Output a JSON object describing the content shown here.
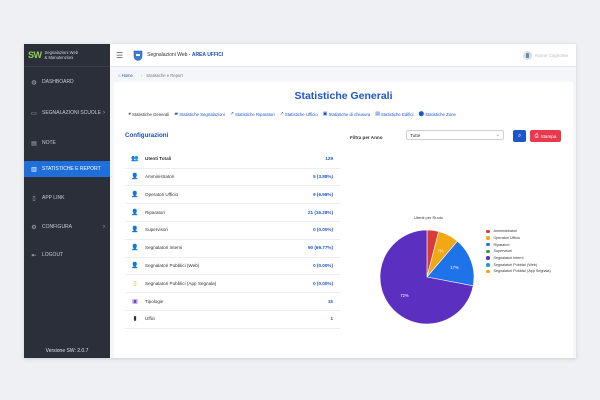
{
  "sidebar": {
    "logo": "SW",
    "brand_line1": "Segnalazioni Web",
    "brand_line2": "& Manutenzioni",
    "items": [
      {
        "label": "DASHBOARD",
        "icon": "dashboard-icon",
        "glyph": "◍",
        "chevron": ""
      },
      {
        "label": "SEGNALAZIONI SCUOLE",
        "icon": "message-icon",
        "glyph": "▭",
        "chevron": "›"
      },
      {
        "label": "NOTE",
        "icon": "notes-icon",
        "glyph": "▤",
        "chevron": ""
      },
      {
        "label": "STATISTICHE E REPORT",
        "icon": "chart-icon",
        "glyph": "▥",
        "chevron": ""
      },
      {
        "label": "APP LINK",
        "icon": "phone-icon",
        "glyph": "▯",
        "chevron": ""
      },
      {
        "label": "CONFIGURA",
        "icon": "gear-icon",
        "glyph": "⚙",
        "chevron": "›"
      },
      {
        "label": "LOGOUT",
        "icon": "logout-icon",
        "glyph": "⇤",
        "chevron": ""
      }
    ],
    "active_index": 3,
    "version": "Versione SW: 2.0.7"
  },
  "header": {
    "title_prefix": "Segnalazioni Web - ",
    "title_area": "AREA UFFICI",
    "user_name": "Nome Cognome"
  },
  "breadcrumb": {
    "home": "Home",
    "current": "Statistiche e Report"
  },
  "page_title": "Statistiche Generali",
  "tabs": [
    {
      "label": "Statistiche Generali",
      "glyph": "◕"
    },
    {
      "label": "Statistiche Segnalazioni",
      "glyph": "▰"
    },
    {
      "label": "Statistiche Riparatori",
      "glyph": "↗"
    },
    {
      "label": "Statistiche Ufficio",
      "glyph": "↗"
    },
    {
      "label": "Statistiche di chiusura",
      "glyph": "▣"
    },
    {
      "label": "Statistiche Edifici",
      "glyph": "▤"
    },
    {
      "label": "Statistiche Zone",
      "glyph": "⬤"
    }
  ],
  "config_title": "Configurazioni",
  "stats": [
    {
      "label": "Utenti Totali",
      "value": "129",
      "bold": true,
      "glyph": "👥",
      "color": "#1e56c8"
    },
    {
      "label": "Amministratori",
      "value": "5 (3.88%)",
      "bold": false,
      "glyph": "👤",
      "color": "#d93a3a"
    },
    {
      "label": "Operatori Ufficio",
      "value": "9 (6.98%)",
      "bold": false,
      "glyph": "👤",
      "color": "#e8a317"
    },
    {
      "label": "Riparatori",
      "value": "21 (16.28%)",
      "bold": false,
      "glyph": "👤",
      "color": "#1e56c8"
    },
    {
      "label": "Supervisori",
      "value": "0 (0.00%)",
      "bold": false,
      "glyph": "👤",
      "color": "#2f9e44"
    },
    {
      "label": "Segnalatori Interni",
      "value": "90 (69.77%)",
      "bold": false,
      "glyph": "👤",
      "color": "#5b3cc4"
    },
    {
      "label": "Segnalatori Pubblici (Web)",
      "value": "0 (0.00%)",
      "bold": false,
      "glyph": "👤",
      "color": "#17a2b8"
    },
    {
      "label": "Segnalatori Pubblici (App Segnala)",
      "value": "0 (0.00%)",
      "bold": false,
      "glyph": "▯",
      "color": "#e8a317"
    },
    {
      "label": "Tipologie",
      "value": "15",
      "bold": false,
      "glyph": "▣",
      "color": "#7b3fc4"
    },
    {
      "label": "Uffici",
      "value": "1",
      "bold": false,
      "glyph": "▮",
      "color": "#333333"
    }
  ],
  "filter": {
    "label": "Filtra per Anno",
    "selected": "Tutte"
  },
  "print_label": "Stampa",
  "chart_data": {
    "type": "pie",
    "title": "Utenti per Ruolo",
    "slices": [
      {
        "label": "Amministratori",
        "value": 5,
        "color": "#d93a3a",
        "pct_label": ""
      },
      {
        "label": "Operatori Ufficio",
        "value": 9,
        "color": "#f0a814",
        "pct_label": "7%"
      },
      {
        "label": "Riparatori",
        "value": 21,
        "color": "#1e73e8",
        "pct_label": "17%"
      },
      {
        "label": "Supervisori",
        "value": 0,
        "color": "#2f9e44",
        "pct_label": ""
      },
      {
        "label": "Segnalatori Interni",
        "value": 90,
        "color": "#5b2fc0",
        "pct_label": "72%"
      },
      {
        "label": "Segnalatori Pubblici (Web)",
        "value": 0,
        "color": "#17a2b8",
        "pct_label": ""
      },
      {
        "label": "Segnalatori Pubblici (App Segnala)",
        "value": 0,
        "color": "#e8a317",
        "pct_label": ""
      }
    ],
    "legend_position": "right"
  }
}
